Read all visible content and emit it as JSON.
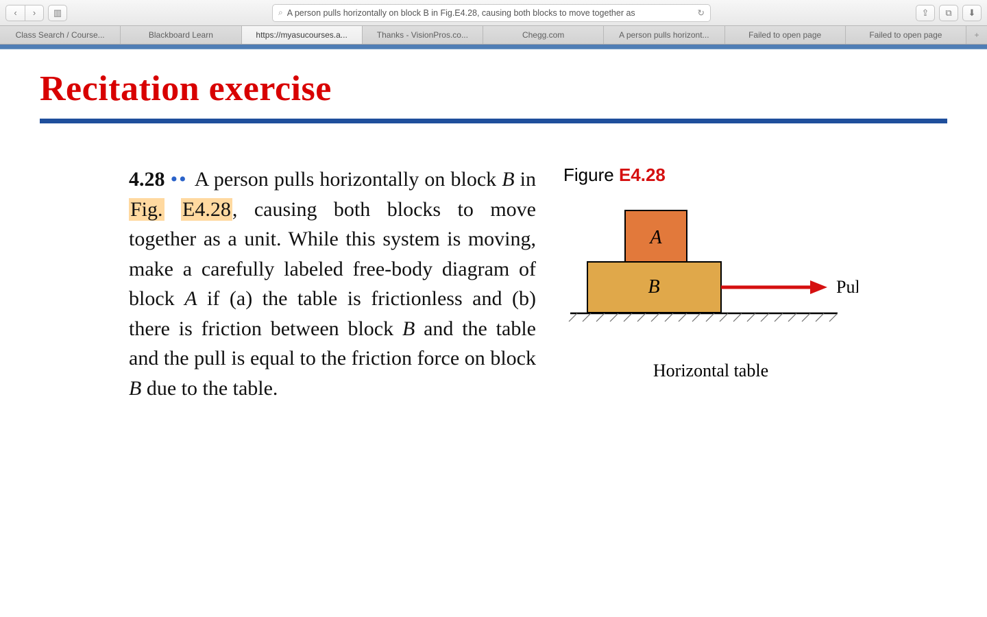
{
  "browser": {
    "address_text": "A person pulls horizontally on block B in Fig.E4.28, causing both blocks to move together as",
    "tabs": [
      "Class Search / Course...",
      "Blackboard Learn",
      "https://myasucourses.a...",
      "Thanks - VisionPros.co...",
      "Chegg.com",
      "A person pulls horizont...",
      "Failed to open page",
      "Failed to open page"
    ],
    "active_tab_index": 2
  },
  "page": {
    "title": "Recitation exercise",
    "problem": {
      "number": "4.28",
      "text_parts": {
        "p1": "A person pulls horizontally on block ",
        "Bvar": "B",
        "p2": " in ",
        "hl1": "Fig.",
        "hl2": "E4.28",
        "p3": ", causing both blocks to move together as a unit. While this system is moving, make a carefully labeled free-body diagram of block ",
        "Avar": "A",
        "p4": " if (a) the table is frictionless and (b) there is friction between block ",
        "Bvar2": "B",
        "p5": " and the table and the pull is equal to the friction force on block ",
        "Bvar3": "B",
        "p6": " due to the table."
      }
    },
    "figure": {
      "label_word": "Figure",
      "label_number": "E4.28",
      "blockA_label": "A",
      "blockB_label": "B",
      "pull_label": "Pull",
      "caption": "Horizontal table"
    }
  },
  "icons": {
    "chev_left": "‹",
    "chev_right": "›",
    "sidebar": "▥",
    "share": "⇪",
    "tabs": "⧉",
    "download": "⬇",
    "plus": "+",
    "reload": "↻",
    "magnify": "⌕"
  }
}
